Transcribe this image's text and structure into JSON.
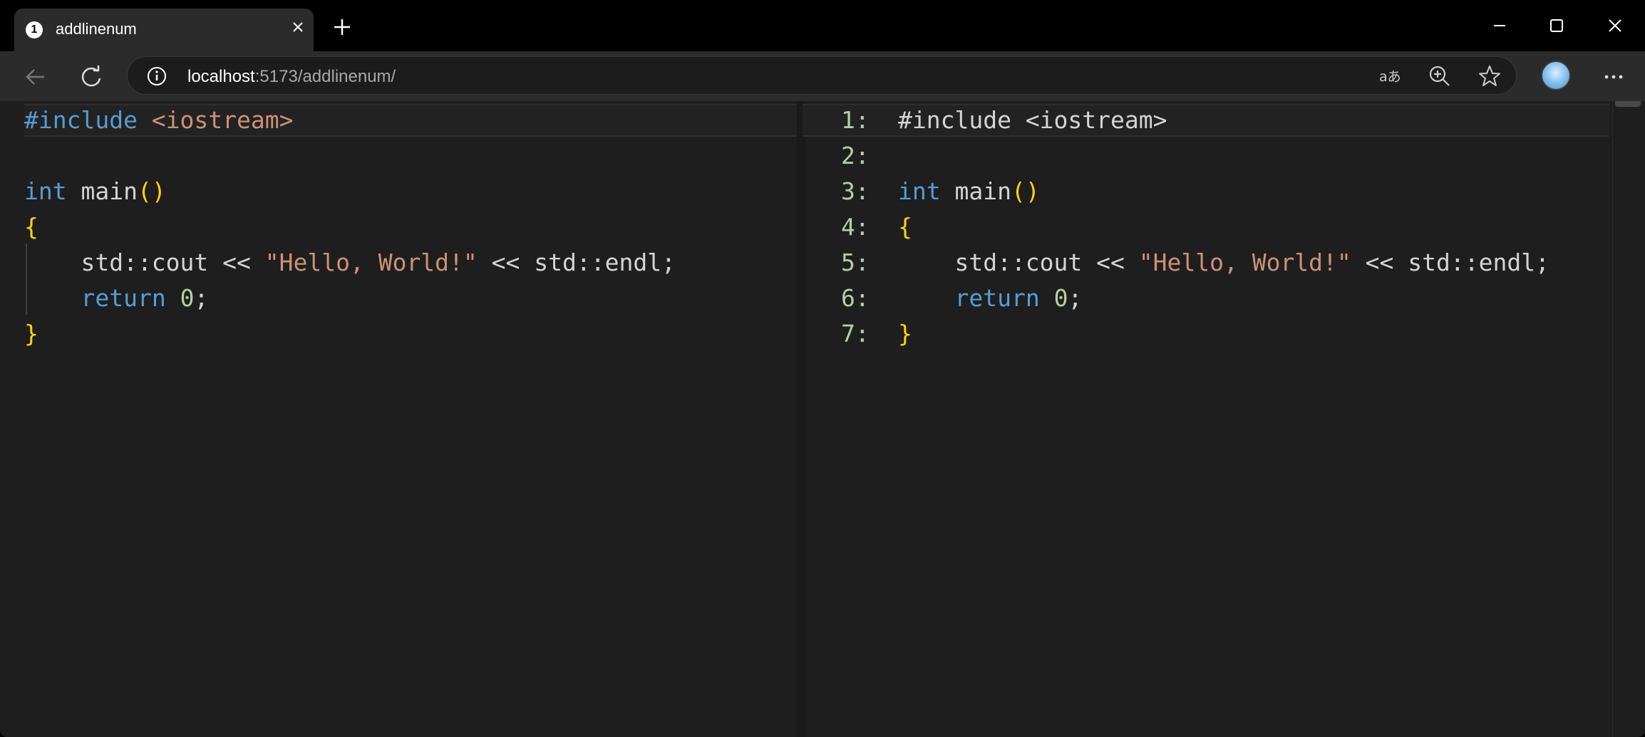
{
  "tab": {
    "title": "addlinenum",
    "favicon_badge": "1"
  },
  "address": {
    "host": "localhost",
    "rest": ":5173/addlinenum/"
  },
  "icons": {
    "back": "back-arrow-icon",
    "reload": "reload-icon",
    "info": "info-icon",
    "read_aloud": "read-aloud-icon",
    "zoom": "zoom-icon",
    "favorite": "star-icon",
    "menu": "more-icon",
    "close_tab": "close-icon",
    "new_tab": "plus-icon",
    "minimize": "minimize-icon",
    "maximize": "maximize-icon",
    "close_window": "close-icon"
  },
  "editor_left": {
    "lines": [
      [
        {
          "t": "#include ",
          "c": "k"
        },
        {
          "t": "<iostream>",
          "c": "s"
        }
      ],
      [],
      [
        {
          "t": "int",
          "c": "k"
        },
        {
          "t": " main",
          "c": ""
        },
        {
          "t": "()",
          "c": "b"
        }
      ],
      [
        {
          "t": "{",
          "c": "b"
        }
      ],
      [
        {
          "t": "    std::cout << ",
          "c": ""
        },
        {
          "t": "\"Hello, World!\"",
          "c": "s"
        },
        {
          "t": " << std::endl;",
          "c": ""
        }
      ],
      [
        {
          "t": "    ",
          "c": ""
        },
        {
          "t": "return",
          "c": "k"
        },
        {
          "t": " ",
          "c": ""
        },
        {
          "t": "0",
          "c": "n"
        },
        {
          "t": ";",
          "c": ""
        }
      ],
      [
        {
          "t": "}",
          "c": "b"
        }
      ]
    ]
  },
  "editor_right": {
    "line_numbers": [
      "1:",
      "2:",
      "3:",
      "4:",
      "5:",
      "6:",
      "7:"
    ],
    "lines": [
      [
        {
          "t": "#include <iostream>",
          "c": ""
        }
      ],
      [],
      [
        {
          "t": "int",
          "c": "k"
        },
        {
          "t": " main",
          "c": ""
        },
        {
          "t": "()",
          "c": "b"
        }
      ],
      [
        {
          "t": "{",
          "c": "b"
        }
      ],
      [
        {
          "t": "    std::cout << ",
          "c": ""
        },
        {
          "t": "\"Hello, World!\"",
          "c": "s"
        },
        {
          "t": " << std::endl;",
          "c": ""
        }
      ],
      [
        {
          "t": "    ",
          "c": ""
        },
        {
          "t": "return",
          "c": "k"
        },
        {
          "t": " ",
          "c": ""
        },
        {
          "t": "0",
          "c": "n"
        },
        {
          "t": ";",
          "c": ""
        }
      ],
      [
        {
          "t": "}",
          "c": "b"
        }
      ]
    ]
  }
}
